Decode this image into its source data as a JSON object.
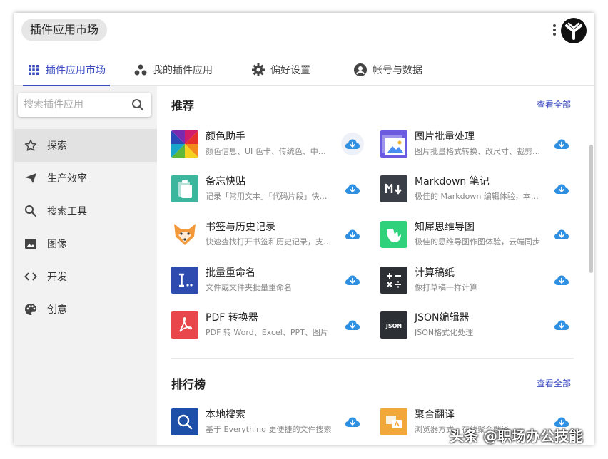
{
  "window": {
    "title": "插件应用市场"
  },
  "tabs": [
    {
      "label": "插件应用市场",
      "icon": "grid-icon"
    },
    {
      "label": "我的插件应用",
      "icon": "dots-icon"
    },
    {
      "label": "偏好设置",
      "icon": "gear-icon"
    },
    {
      "label": "帐号与数据",
      "icon": "account-icon"
    }
  ],
  "sidebar": {
    "search": {
      "placeholder": "搜索插件应用",
      "value": ""
    },
    "items": [
      {
        "label": "探索",
        "icon": "star-icon"
      },
      {
        "label": "生产效率",
        "icon": "send-icon"
      },
      {
        "label": "搜索工具",
        "icon": "search-icon"
      },
      {
        "label": "图像",
        "icon": "image-icon"
      },
      {
        "label": "开发",
        "icon": "code-icon"
      },
      {
        "label": "创意",
        "icon": "palette-icon"
      }
    ]
  },
  "sections": {
    "recommended": {
      "title": "推荐",
      "view_all": "查看全部"
    },
    "ranking": {
      "title": "排行榜",
      "view_all": "查看全部"
    }
  },
  "recommended_apps": [
    {
      "name": "颜色助手",
      "desc": "颜色信息、UI 色卡、传统色、中国色",
      "icon": "color-wheel-icon"
    },
    {
      "name": "图片批量处理",
      "desc": "图片批量格式转换、改尺寸、裁剪、压缩",
      "icon": "image-batch-icon"
    },
    {
      "name": "备忘快贴",
      "desc": "记录「常用文本」「代码片段」快速粘贴",
      "icon": "clipboard-icon"
    },
    {
      "name": "Markdown 笔记",
      "desc": "极佳的 Markdown 编辑体验，本地存储",
      "icon": "markdown-icon"
    },
    {
      "name": "书签与历史记录",
      "desc": "快速查找打开书签和历史记录，支持多浏览器",
      "icon": "fox-icon"
    },
    {
      "name": "知犀思维导图",
      "desc": "极佳的思维导图作图体验，云端同步",
      "icon": "rhino-icon"
    },
    {
      "name": "批量重命名",
      "desc": "文件或文件夹批量重命名",
      "icon": "rename-icon"
    },
    {
      "name": "计算稿纸",
      "desc": "像打草稿一样计算",
      "icon": "calculator-icon"
    },
    {
      "name": "PDF 转换器",
      "desc": "PDF 转 Word、Excel、PPT、图片",
      "icon": "pdf-icon"
    },
    {
      "name": "JSON编辑器",
      "desc": "JSON格式化处理",
      "icon": "json-icon"
    }
  ],
  "ranking_apps": [
    {
      "name": "本地搜索",
      "desc": "基于 Everything 更便捷的文件搜索",
      "icon": "local-search-icon"
    },
    {
      "name": "聚合翻译",
      "desc": "浏览器方式，在线聚合翻译",
      "icon": "translate-icon"
    }
  ],
  "watermark": "头条 @职场办公技能",
  "colors": {
    "accent": "#3b4cc0",
    "download": "#2f8fe0"
  }
}
